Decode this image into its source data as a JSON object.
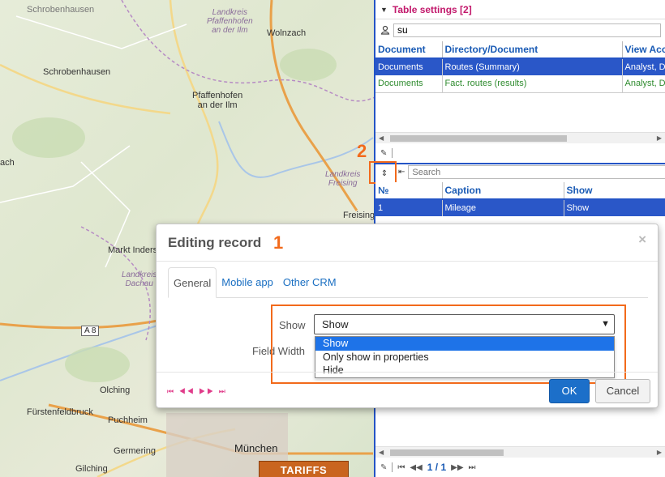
{
  "map": {
    "towns": [
      {
        "id": "schrobenhausen-top",
        "label": "Schrobenhausen"
      },
      {
        "id": "wolnzach",
        "label": "Wolnzach"
      },
      {
        "id": "schrobenhausen",
        "label": "Schrobenhausen"
      },
      {
        "id": "pfaffenhofen",
        "label": "Pfaffenhofen\nan der Ilm"
      },
      {
        "id": "ach",
        "label": "ach"
      },
      {
        "id": "freising",
        "label": "Freising"
      },
      {
        "id": "markt-indersdorf",
        "label": "Markt Inders"
      },
      {
        "id": "olching",
        "label": "Olching"
      },
      {
        "id": "fuerstenfeldbruck",
        "label": "Fürstenfeldbruck"
      },
      {
        "id": "puchheim",
        "label": "Puchheim"
      },
      {
        "id": "germering",
        "label": "Germering"
      },
      {
        "id": "gilching",
        "label": "Gilching"
      }
    ],
    "districts": [
      {
        "id": "landkreis-pfaffenhofen",
        "label": "Landkreis\nPfaffenhofen\nan der Ilm"
      },
      {
        "id": "landkreis-freising",
        "label": "Landkreis\nFreising"
      },
      {
        "id": "landkreis-dachau",
        "label": "Landkreis\nDachau"
      }
    ],
    "city": "München",
    "road_shield": "A 8",
    "tariffs_button": "TARIFFS"
  },
  "table_settings": {
    "toggle_icon": "triangle-down-icon",
    "title": "Table settings [2]",
    "filter_value": "su",
    "columns": [
      "Document",
      "Directory/Document",
      "View Acc"
    ],
    "rows": [
      {
        "cells": [
          "Documents",
          "Routes (Summary)",
          "Analyst, D"
        ],
        "style": "selected"
      },
      {
        "cells": [
          "Documents",
          "Fact. routes (results)",
          "Analyst, D"
        ],
        "style": "green"
      }
    ]
  },
  "fields_table": {
    "search_placeholder": "Search",
    "columns": [
      "№",
      "Caption",
      "Show"
    ],
    "rows": [
      {
        "cells": [
          "1",
          "Mileage",
          "Show"
        ],
        "style": "selected"
      }
    ],
    "pager": "1 / 1"
  },
  "annotations": {
    "one": "1",
    "two": "2"
  },
  "modal": {
    "title": "Editing record",
    "close": "×",
    "tabs": [
      {
        "label": "General",
        "active": true
      },
      {
        "label": "Mobile app",
        "active": false
      },
      {
        "label": "Other CRM",
        "active": false
      }
    ],
    "show_label": "Show",
    "show_value": "Show",
    "field_width_label": "Field Width",
    "options": [
      "Show",
      "Only show in properties",
      "Hide"
    ],
    "selected_option": "Show",
    "nav_arrows": "⏮ ◀◀ ▶▶ ⏭",
    "ok": "OK",
    "cancel": "Cancel"
  },
  "colors": {
    "accent_blue": "#2a57c8",
    "annotation_orange": "#f26a1b",
    "title_pink": "#c2186b",
    "ok_blue": "#1c6fc9"
  }
}
